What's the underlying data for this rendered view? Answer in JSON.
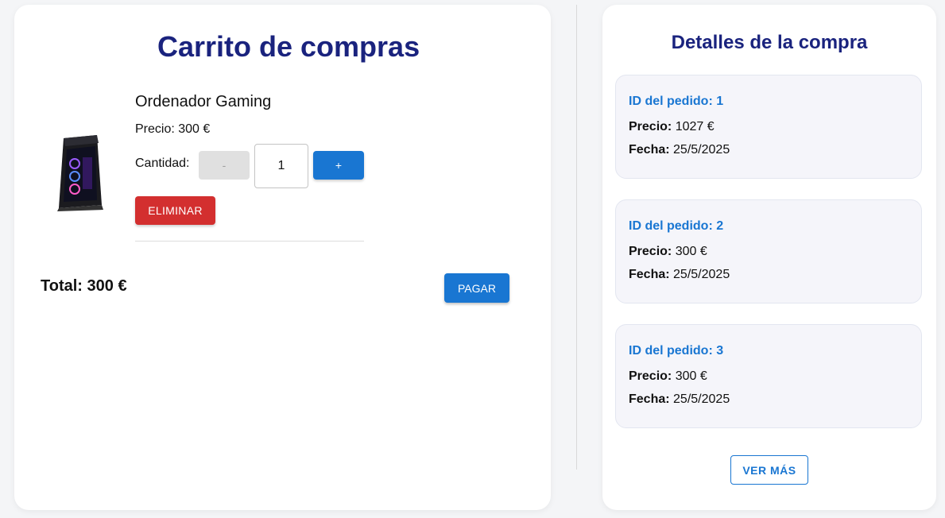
{
  "cart": {
    "title": "Carrito de compras",
    "item": {
      "name": "Ordenador Gaming",
      "price_label": "Precio:",
      "price_value": "300 €",
      "quantity_label": "Cantidad:",
      "quantity": "1",
      "minus_label": "-",
      "plus_label": "+",
      "delete_label": "ELIMINAR",
      "image_icon": "gaming-pc-tower-image"
    },
    "total_label": "Total:",
    "total_value": "300 €",
    "pay_label": "PAGAR"
  },
  "details": {
    "title": "Detalles de la compra",
    "order_id_label": "ID del pedido:",
    "price_label": "Precio:",
    "date_label": "Fecha:",
    "orders": [
      {
        "id": "1",
        "price": "1027 €",
        "date": "25/5/2025"
      },
      {
        "id": "2",
        "price": "300 €",
        "date": "25/5/2025"
      },
      {
        "id": "3",
        "price": "300 €",
        "date": "25/5/2025"
      }
    ],
    "more_label": "VER MÁS"
  },
  "colors": {
    "title": "#1a237e",
    "primary": "#1976d2",
    "danger": "#d32f2f",
    "disabled": "#e0e0e0",
    "order_bg": "#f5f5fa"
  }
}
